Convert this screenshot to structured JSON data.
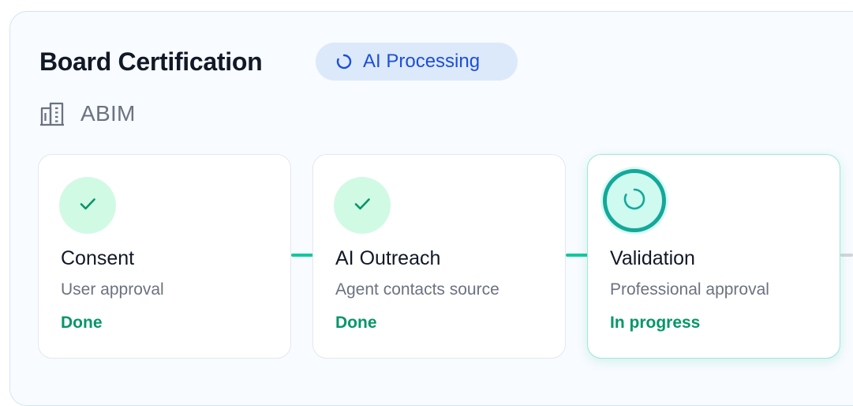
{
  "header": {
    "title": "Board Certification",
    "badge": {
      "label": "AI Processing",
      "icon": "spinner-icon",
      "color": "#1d4ed8",
      "background": "#dce9fb"
    }
  },
  "organization": {
    "name": "ABIM",
    "icon": "building-icon"
  },
  "steps": [
    {
      "title": "Consent",
      "subtitle": "User approval",
      "status": "Done",
      "state": "complete",
      "icon": "check-icon"
    },
    {
      "title": "AI Outreach",
      "subtitle": "Agent contacts source",
      "status": "Done",
      "state": "complete",
      "icon": "check-icon"
    },
    {
      "title": "Validation",
      "subtitle": "Professional approval",
      "status": "In progress",
      "state": "active",
      "icon": "spinner-icon"
    }
  ],
  "colors": {
    "accent_green": "#059669",
    "connector_complete": "#10c9a0",
    "connector_pending": "#d1d5db",
    "active_ring": "#14a89a"
  }
}
